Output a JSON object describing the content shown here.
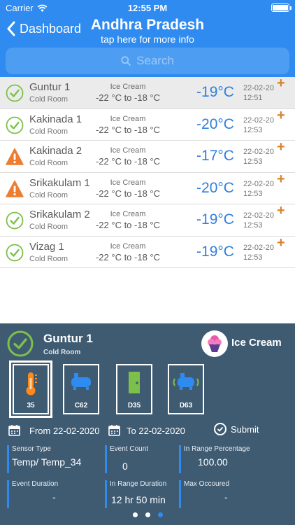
{
  "status_bar": {
    "carrier": "Carrier",
    "time": "12:55 PM"
  },
  "header": {
    "back_label": "Dashboard",
    "title": "Andhra Pradesh",
    "subtitle": "tap here for more info"
  },
  "search": {
    "placeholder": "Search"
  },
  "colors": {
    "primary": "#2f8bf0",
    "ok": "#7cc04b",
    "warning": "#ee7d2f",
    "temp": "#2f7fe0",
    "panel": "#3f5b72",
    "add": "#d9822b"
  },
  "list": [
    {
      "name": "Guntur 1",
      "type": "Cold Room",
      "product": "Ice Cream",
      "range": "-22 °C to -18 °C",
      "temp": "-19°C",
      "date": "22-02-20",
      "time": "12:51",
      "status": "ok",
      "selected": true
    },
    {
      "name": "Kakinada 1",
      "type": "Cold Room",
      "product": "Ice Cream",
      "range": "-22 °C to -18 °C",
      "temp": "-20°C",
      "date": "22-02-20",
      "time": "12:53",
      "status": "ok",
      "selected": false
    },
    {
      "name": "Kakinada 2",
      "type": "Cold Room",
      "product": "Ice Cream",
      "range": "-22 °C to -18 °C",
      "temp": "-17°C",
      "date": "22-02-20",
      "time": "12:53",
      "status": "warning",
      "selected": false
    },
    {
      "name": "Srikakulam 1",
      "type": "Cold Room",
      "product": "Ice Cream",
      "range": "-22 °C to -18 °C",
      "temp": "-20°C",
      "date": "22-02-20",
      "time": "12:53",
      "status": "warning",
      "selected": false
    },
    {
      "name": "Srikakulam 2",
      "type": "Cold Room",
      "product": "Ice Cream",
      "range": "-22 °C to -18 °C",
      "temp": "-19°C",
      "date": "22-02-20",
      "time": "12:53",
      "status": "ok",
      "selected": false
    },
    {
      "name": "Vizag 1",
      "type": "Cold Room",
      "product": "Ice Cream",
      "range": "-22 °C to -18 °C",
      "temp": "-19°C",
      "date": "22-02-20",
      "time": "12:53",
      "status": "ok",
      "selected": false
    }
  ],
  "add_symbol": "+",
  "detail": {
    "name": "Guntur 1",
    "type": "Cold Room",
    "product": "Ice Cream",
    "sensors": [
      {
        "label": "35",
        "icon": "thermometer-icon",
        "active": true
      },
      {
        "label": "C62",
        "icon": "compressor-icon",
        "active": false
      },
      {
        "label": "D35",
        "icon": "door-icon",
        "active": false
      },
      {
        "label": "D63",
        "icon": "compressor-vibration-icon",
        "active": false
      }
    ],
    "from": "From 22-02-2020",
    "to": "To 22-02-2020",
    "submit": "Submit",
    "stats": [
      {
        "label": "Sensor Type",
        "value": "Temp/ Temp_34"
      },
      {
        "label": "Event Count",
        "value": "0"
      },
      {
        "label": "In Range Percentage",
        "value": "100.00"
      },
      {
        "label": "Event Duration",
        "value": "-"
      },
      {
        "label": "In Range Duration",
        "value": "12 hr 50 min"
      },
      {
        "label": "Max Occoured",
        "value": "-"
      }
    ],
    "page_indicator": {
      "count": 3,
      "current": 3
    }
  }
}
